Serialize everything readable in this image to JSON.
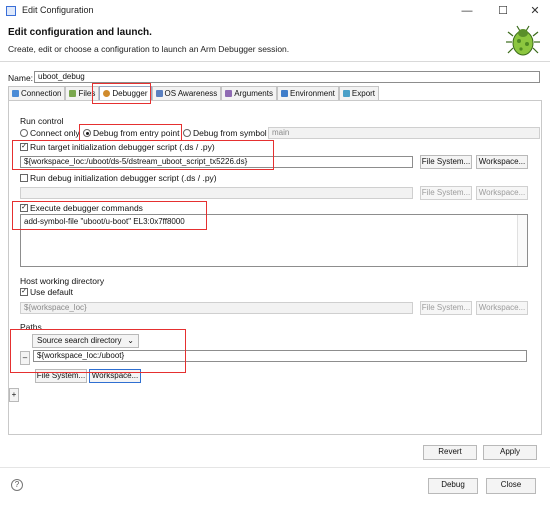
{
  "window": {
    "title": "Edit Configuration",
    "minimize": "—",
    "maximize": "☐",
    "close": "✕"
  },
  "header": {
    "title": "Edit configuration and launch.",
    "subtitle": "Create, edit or choose a configuration to launch an Arm Debugger session."
  },
  "name": {
    "label": "Name:",
    "value": "uboot_debug"
  },
  "tabs": [
    {
      "label": "Connection",
      "color": "#4a8bd6"
    },
    {
      "label": "Files",
      "color": "#7aa84e"
    },
    {
      "label": "Debugger",
      "color": "#d08b2c"
    },
    {
      "label": "OS Awareness",
      "color": "#5a7fc0"
    },
    {
      "label": "Arguments",
      "color": "#8f6bb3"
    },
    {
      "label": "Environment",
      "color": "#3f7dc9"
    },
    {
      "label": "Export",
      "color": "#4aa0c8"
    }
  ],
  "run_control": {
    "group_label": "Run control",
    "connect_only": "Connect only",
    "debug_entry": "Debug from entry point",
    "debug_symbol": "Debug from symbol",
    "symbol_value": "main",
    "run_target_script": "Run target initialization debugger script (.ds / .py)",
    "target_script_path": "${workspace_loc:/uboot/ds-5/dstream_uboot_script_tx5226.ds}",
    "run_debug_script": "Run debug initialization debugger script (.ds / .py)",
    "debug_script_path": "",
    "execute_cmds": "Execute debugger commands",
    "commands": "add-symbol-file \"uboot/u-boot\" EL3:0x7ff8000"
  },
  "host_dir": {
    "group_label": "Host working directory",
    "use_default": "Use default",
    "path": "${workspace_loc}"
  },
  "paths": {
    "group_label": "Paths",
    "type_select": "Source search directory",
    "remove": "–",
    "path": "${workspace_loc:/uboot}",
    "add": "+"
  },
  "buttons": {
    "file_system": "File System...",
    "workspace": "Workspace...",
    "revert": "Revert",
    "apply": "Apply",
    "debug": "Debug",
    "close": "Close",
    "help": "?"
  }
}
